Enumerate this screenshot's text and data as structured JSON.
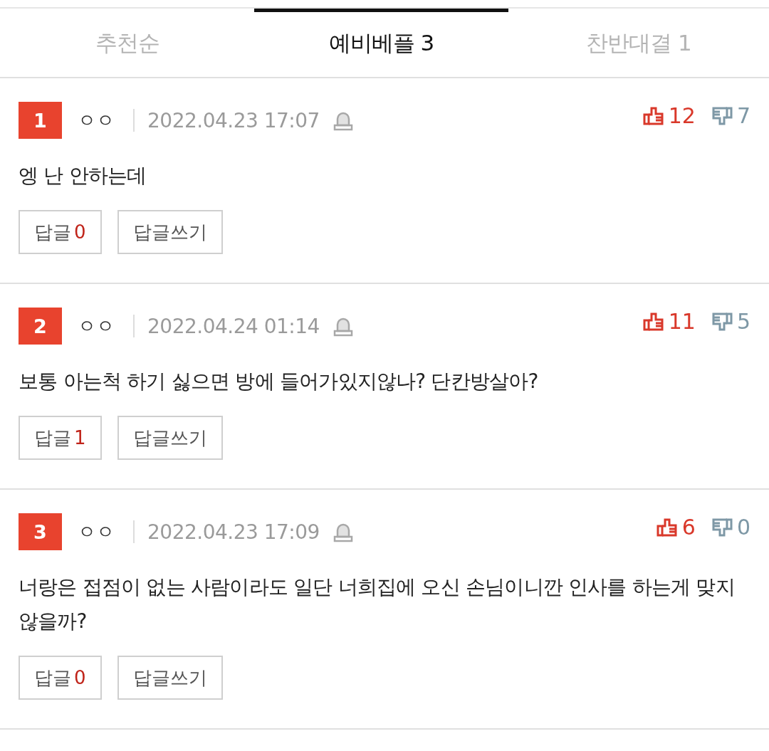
{
  "tabs": [
    {
      "label": "추천순",
      "selected": false
    },
    {
      "label": "예비베플 3",
      "selected": true
    },
    {
      "label": "찬반대결 1",
      "selected": false
    }
  ],
  "comments": [
    {
      "rank": "1",
      "author": "ㅇㅇ",
      "date": "2022.04.23 17:07",
      "likes": "12",
      "dislikes": "7",
      "text": "엥 난 안하는데",
      "reply_label": "답글",
      "reply_count": "0",
      "write_reply": "답글쓰기"
    },
    {
      "rank": "2",
      "author": "ㅇㅇ",
      "date": "2022.04.24 01:14",
      "likes": "11",
      "dislikes": "5",
      "text": "보통 아는척 하기 싫으면 방에 들어가있지않나? 단칸방살아?",
      "reply_label": "답글",
      "reply_count": "1",
      "write_reply": "답글쓰기"
    },
    {
      "rank": "3",
      "author": "ㅇㅇ",
      "date": "2022.04.23 17:09",
      "likes": "6",
      "dislikes": "0",
      "text": "너랑은 접점이 없는 사람이라도 일단 너희집에 오신 손님이니깐 인사를 하는게 맞지않을까?",
      "reply_label": "답글",
      "reply_count": "0",
      "write_reply": "답글쓰기"
    }
  ]
}
